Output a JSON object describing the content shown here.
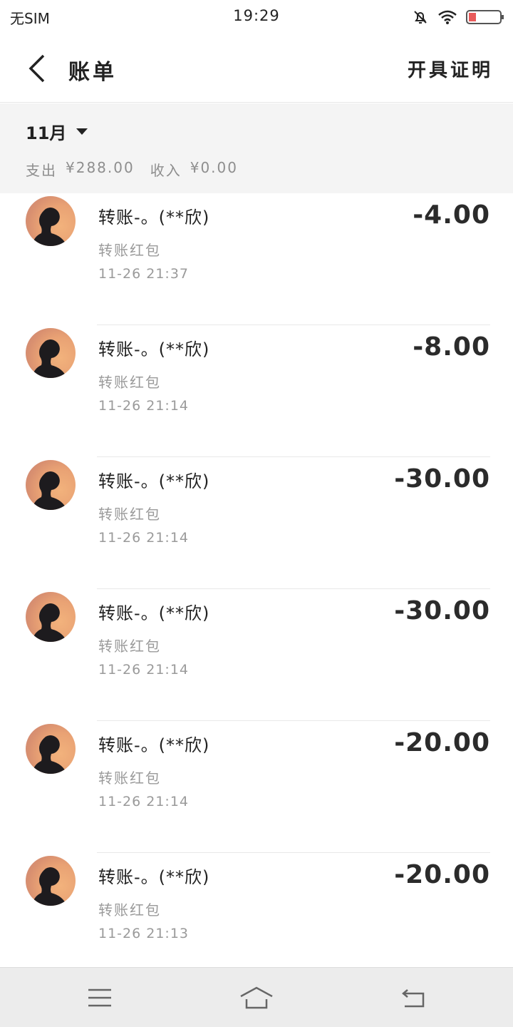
{
  "status_bar": {
    "carrier": "无SIM",
    "time": "19:29",
    "icons": [
      "bell-off-icon",
      "wifi-icon",
      "battery-low-icon"
    ]
  },
  "header": {
    "title": "账单",
    "certificate_label": "开具证明",
    "back_icon": "chevron-left-icon"
  },
  "summary": {
    "month": "11月",
    "expense_label": "支出",
    "expense_value": "¥288.00",
    "income_label": "收入",
    "income_value": "¥0.00"
  },
  "transactions": [
    {
      "name": "转账-。(**欣)",
      "type": "转账红包",
      "time": "11-26  21:37",
      "amount": "-4.00"
    },
    {
      "name": "转账-。(**欣)",
      "type": "转账红包",
      "time": "11-26  21:14",
      "amount": "-8.00"
    },
    {
      "name": "转账-。(**欣)",
      "type": "转账红包",
      "time": "11-26  21:14",
      "amount": "-30.00"
    },
    {
      "name": "转账-。(**欣)",
      "type": "转账红包",
      "time": "11-26  21:14",
      "amount": "-30.00"
    },
    {
      "name": "转账-。(**欣)",
      "type": "转账红包",
      "time": "11-26  21:14",
      "amount": "-20.00"
    },
    {
      "name": "转账-。(**欣)",
      "type": "转账红包",
      "time": "11-26  21:13",
      "amount": "-20.00"
    }
  ],
  "nav_bar": {
    "icons": [
      "menu-icon",
      "home-icon",
      "back-icon"
    ]
  },
  "colors": {
    "summary_bg": "#f4f4f4",
    "secondary_text": "#9a9a9a",
    "nav_bg": "#ececec"
  }
}
